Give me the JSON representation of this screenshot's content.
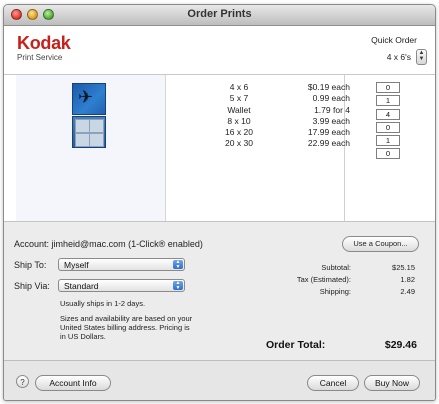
{
  "window": {
    "title": "Order Prints"
  },
  "brand": {
    "name": "Kodak",
    "subtitle": "Print Service"
  },
  "quick_order": {
    "label": "Quick Order",
    "value": "4 x 6's"
  },
  "products": {
    "sizes": [
      "4 x 6",
      "5 x 7",
      "Wallet",
      "8 x 10",
      "16 x 20",
      "20 x 30"
    ],
    "prices": [
      "$0.19 each",
      "0.99 each",
      "1.79 for 4",
      "3.99 each",
      "17.99 each",
      "22.99 each"
    ],
    "quantities": [
      "0",
      "1",
      "4",
      "0",
      "1",
      "0"
    ]
  },
  "account": {
    "text": "Account: jimheid@mac.com (1-Click® enabled)"
  },
  "coupon_button": "Use a Coupon...",
  "ship_to": {
    "label": "Ship To:",
    "value": "Myself"
  },
  "ship_via": {
    "label": "Ship Via:",
    "value": "Standard"
  },
  "shipping_note": "Usually ships in 1-2 days.",
  "availability_note": [
    "Sizes and availability are based on your",
    "United States billing address. Pricing is",
    "in US Dollars."
  ],
  "totals": {
    "subtotal_label": "Subtotal:",
    "subtotal": "$25.15",
    "tax_label": "Tax (Estimated):",
    "tax": "1.82",
    "shipping_label": "Shipping:",
    "shipping": "2.49",
    "order_total_label": "Order Total:",
    "order_total": "$29.46"
  },
  "footer": {
    "help_glyph": "?",
    "account_info_button": "Account Info",
    "cancel_button": "Cancel",
    "buy_now_button": "Buy Now"
  },
  "colors": {
    "kodak_red": "#c8211b",
    "popup_blue": "#2d6ed0"
  },
  "icons": [
    "close-icon",
    "minimize-icon",
    "zoom-icon",
    "stepper-icon",
    "popup-arrows-icon",
    "help-icon"
  ]
}
